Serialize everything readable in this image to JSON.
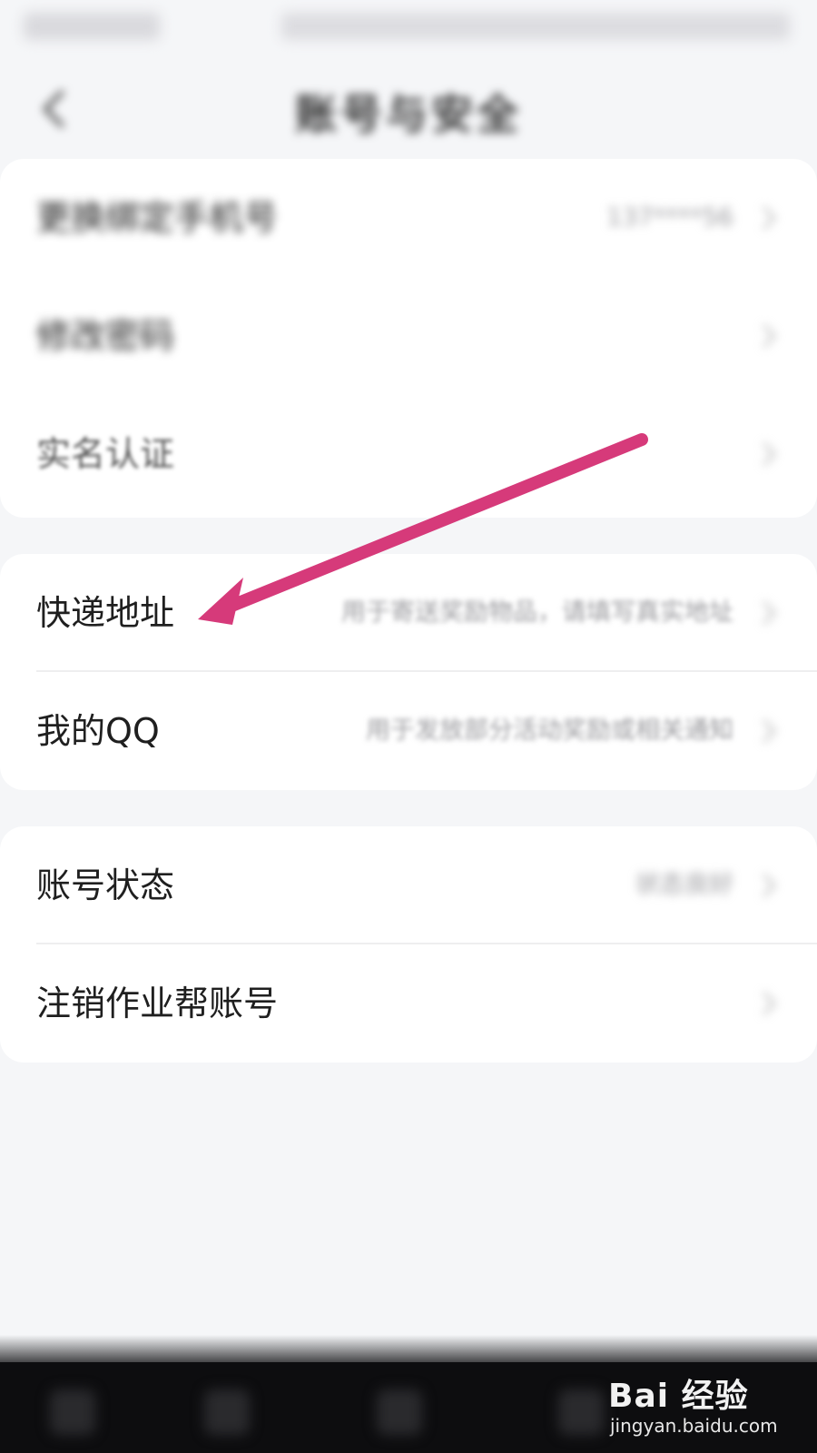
{
  "header": {
    "title": "账号与安全"
  },
  "sections": [
    {
      "rows": [
        {
          "label": "更换绑定手机号",
          "value": "137****56"
        },
        {
          "label": "修改密码",
          "value": ""
        },
        {
          "label": "实名认证",
          "value": ""
        }
      ]
    },
    {
      "rows": [
        {
          "label": "快递地址",
          "value": "用于寄送奖励物品，请填写真实地址"
        },
        {
          "label": "我的QQ",
          "value": "用于发放部分活动奖励或相关通知"
        }
      ]
    },
    {
      "rows": [
        {
          "label": "账号状态",
          "value": "状态良好"
        },
        {
          "label": "注销作业帮账号",
          "value": ""
        }
      ]
    }
  ],
  "watermark": {
    "logo": "Bai 经验",
    "url": "jingyan.baidu.com"
  },
  "colors": {
    "annotation_arrow": "#d63a7a",
    "background": "#f5f6f8",
    "card": "#ffffff"
  },
  "icons": {
    "back": "chevron-left-icon",
    "row_chevron": "chevron-right-icon"
  }
}
